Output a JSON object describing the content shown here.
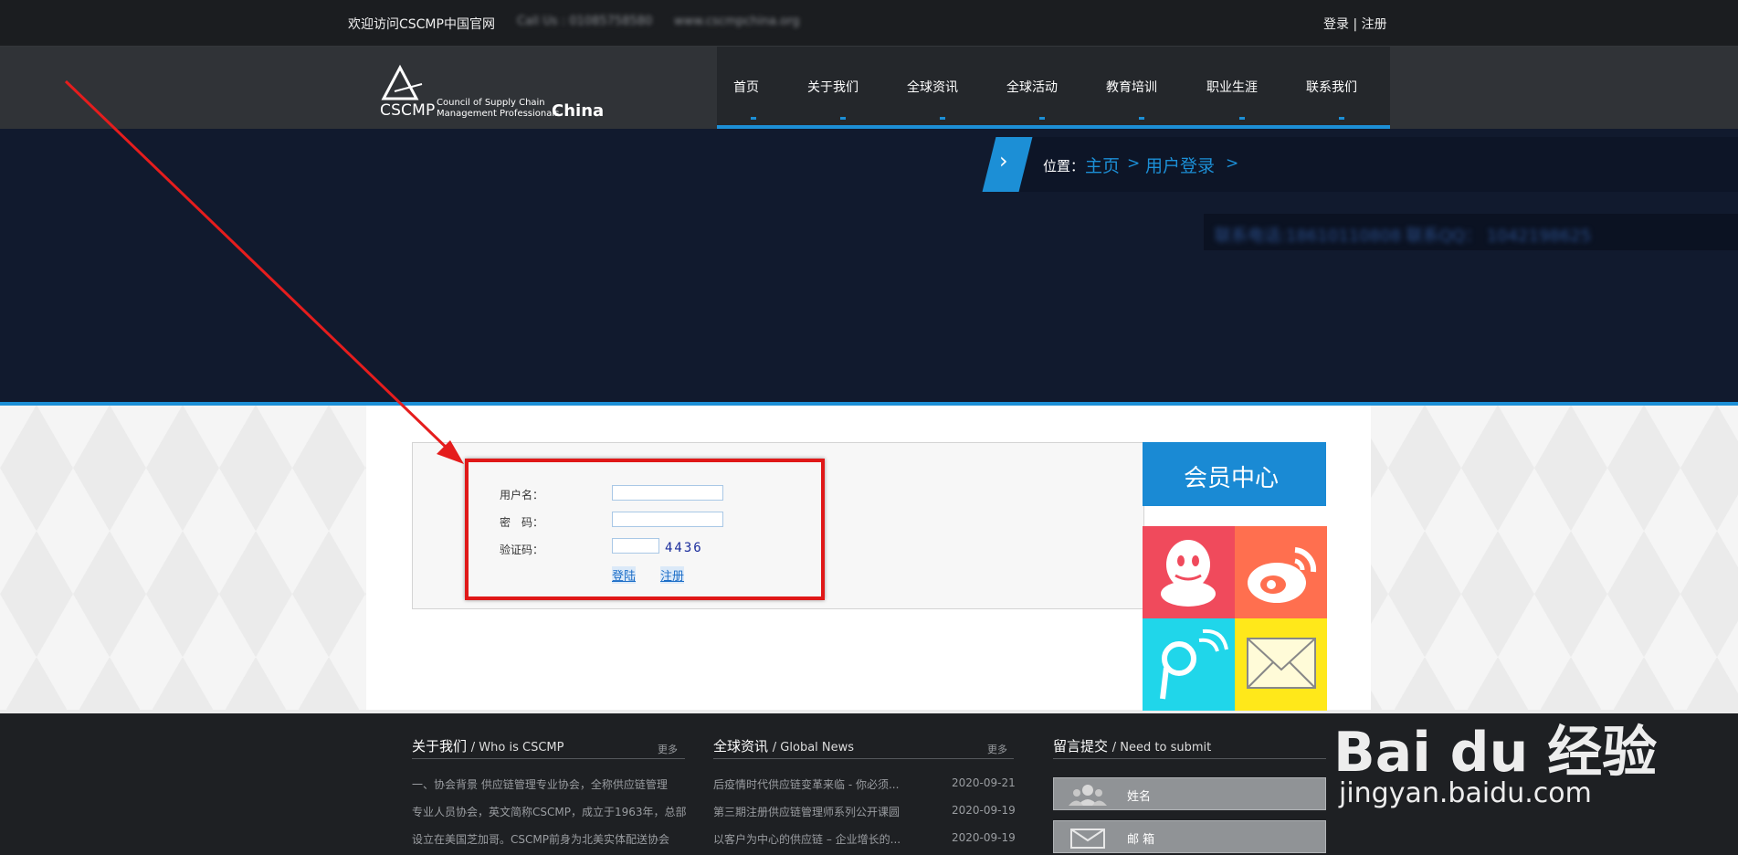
{
  "topbar": {
    "welcome": "欢迎访问CSCMP中国官网",
    "call": "Call Us : 01085758580",
    "site": "www.cscmpchina.org",
    "login": "登录",
    "sep": "|",
    "register": "注册"
  },
  "logo": {
    "abbr": "CSCMP",
    "line1": "Council of Supply Chain",
    "line2": "Management Professionals",
    "country": "China"
  },
  "nav": {
    "items": [
      "首页",
      "关于我们",
      "全球资讯",
      "全球活动",
      "教育培训",
      "职业生涯",
      "联系我们"
    ]
  },
  "breadcrumb": {
    "arrow": "›",
    "label": "位置：",
    "home": "主页",
    "sep": ">",
    "current": "用户登录"
  },
  "contact": {
    "text": "联系电话:18610110808 联系QQ： 1042198625"
  },
  "login_form": {
    "username_label": "用户名：",
    "password_label": "密　码：",
    "captcha_label": "验证码：",
    "username_value": "",
    "password_value": "",
    "captcha_value": "",
    "captcha_code": "4436",
    "login_link": "登陆",
    "register_link": "注册"
  },
  "member_center": {
    "title": "会员中心",
    "tiles": [
      {
        "icon": "qq-icon",
        "color": "#f04a5c"
      },
      {
        "icon": "weibo-icon",
        "color": "#ff6f4f"
      },
      {
        "icon": "tencent-weibo-icon",
        "color": "#20d6ea"
      },
      {
        "icon": "mail-icon",
        "color": "#ffe81a"
      }
    ]
  },
  "footer": {
    "about": {
      "title": "关于我们",
      "subtitle": "/ Who is CSCMP",
      "more": "更多",
      "lines": [
        "一、协会背景 供应链管理专业协会，全称供应链管理",
        "专业人员协会，英文简称CSCMP，成立于1963年，总部",
        "设立在美国芝加哥。CSCMP前身为北美实体配送协会"
      ]
    },
    "news": {
      "title": "全球资讯",
      "subtitle": "/ Global News",
      "more": "更多",
      "items": [
        {
          "title": "后疫情时代供应链变革来临 - 你必须...",
          "date": "2020-09-21"
        },
        {
          "title": "第三期注册供应链管理师系列公开课圆",
          "date": "2020-09-19"
        },
        {
          "title": "以客户为中心的供应链 – 企业增长的...",
          "date": "2020-09-19"
        }
      ]
    },
    "submit": {
      "title": "留言提交",
      "subtitle": "/ Need to submit",
      "name_label": "姓名",
      "email_label": "邮 箱"
    }
  },
  "watermark": {
    "brand": "Bai du 经验",
    "url": "jingyan.baidu.com"
  },
  "colors": {
    "accent": "#1c8fd6",
    "highlight": "#e01818"
  }
}
